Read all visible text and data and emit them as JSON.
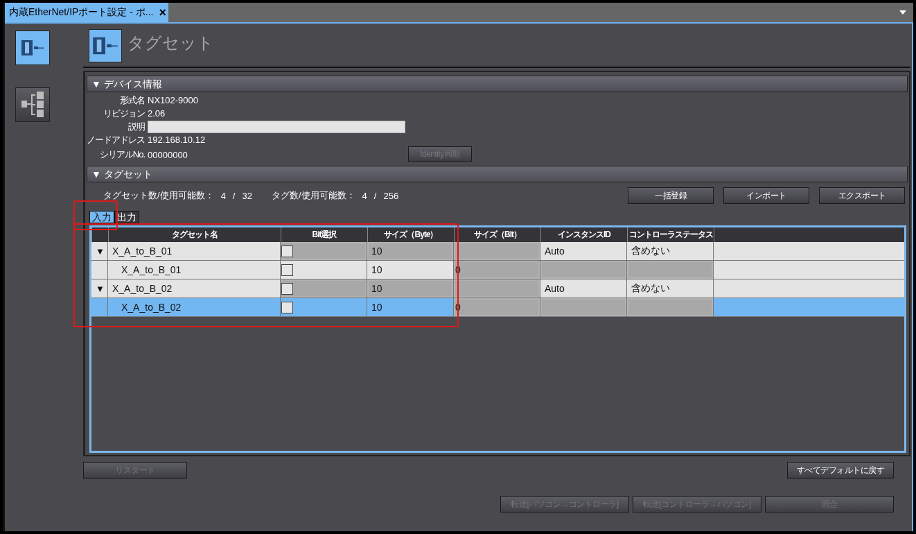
{
  "document_tab": {
    "title": "内蔵EtherNet/IPポート設定 - ポ...",
    "close": "×",
    "selected": true
  },
  "sidebar": {
    "items": [
      {
        "kind": "device",
        "selected": true
      },
      {
        "kind": "tree",
        "selected": false
      }
    ]
  },
  "page_title": "タグセット",
  "device_info": {
    "header": "▼ デバイス情報",
    "fields": [
      {
        "label": "形式名",
        "value": "NX102-9000",
        "kind": "text"
      },
      {
        "label": "リビジョン",
        "value": "2.06",
        "kind": "text"
      },
      {
        "label": "説明",
        "kind": "input"
      },
      {
        "label": "ノードアドレス",
        "value": "192.168.10.12",
        "kind": "text"
      },
      {
        "label": "シリアルNo.",
        "value": "00000000",
        "kind": "text"
      }
    ],
    "identity_button": {
      "label": "Identity同期",
      "disabled": true
    }
  },
  "tagset": {
    "header": "▼ タグセット",
    "counts": [
      {
        "label": "タグセット数/使用可能数：",
        "used": "4",
        "sep": "/",
        "max": "32"
      },
      {
        "label": "タグ数/使用可能数：",
        "used": "4",
        "sep": "/",
        "max": "256"
      }
    ],
    "buttons": [
      {
        "label": "一括登録",
        "disabled": false
      },
      {
        "label": "インポート",
        "disabled": false
      },
      {
        "label": "エクスポート",
        "disabled": false
      }
    ],
    "tabs": [
      {
        "label": "入力",
        "selected": true
      },
      {
        "label": "出力",
        "selected": false
      }
    ],
    "table": {
      "columns": [
        "タグセット名",
        "Bit選択",
        "サイズ（Byte）",
        "サイズ（Bit）",
        "インスタンスID",
        "コントローラステータス"
      ],
      "rows": [
        {
          "kind": "group",
          "expander": "▼",
          "name": "X_A_to_B_01",
          "bit_select": false,
          "size_byte": "10",
          "instance_id": "Auto",
          "controller_status": "含めない",
          "selected": false
        },
        {
          "kind": "member",
          "name": "X_A_to_B_01",
          "bit_select": false,
          "size_byte": "10",
          "size_bit": "0",
          "selected": false
        },
        {
          "kind": "group",
          "expander": "▼",
          "name": "X_A_to_B_02",
          "bit_select": false,
          "size_byte": "10",
          "instance_id": "Auto",
          "controller_status": "含めない",
          "selected": false
        },
        {
          "kind": "member",
          "name": "X_A_to_B_02",
          "bit_select": false,
          "size_byte": "10",
          "size_bit": "0",
          "selected": true
        }
      ]
    }
  },
  "restart_button": {
    "label": "リスタート",
    "disabled": true
  },
  "reset_button": {
    "label": "すべてデフォルトに戻す",
    "disabled": false
  },
  "footer_buttons": [
    {
      "label": "転送[パソコン→コントローラ]",
      "disabled": true
    },
    {
      "label": "転送[コントローラ→パソコン]",
      "disabled": true
    },
    {
      "label": "照合",
      "disabled": true
    }
  ]
}
